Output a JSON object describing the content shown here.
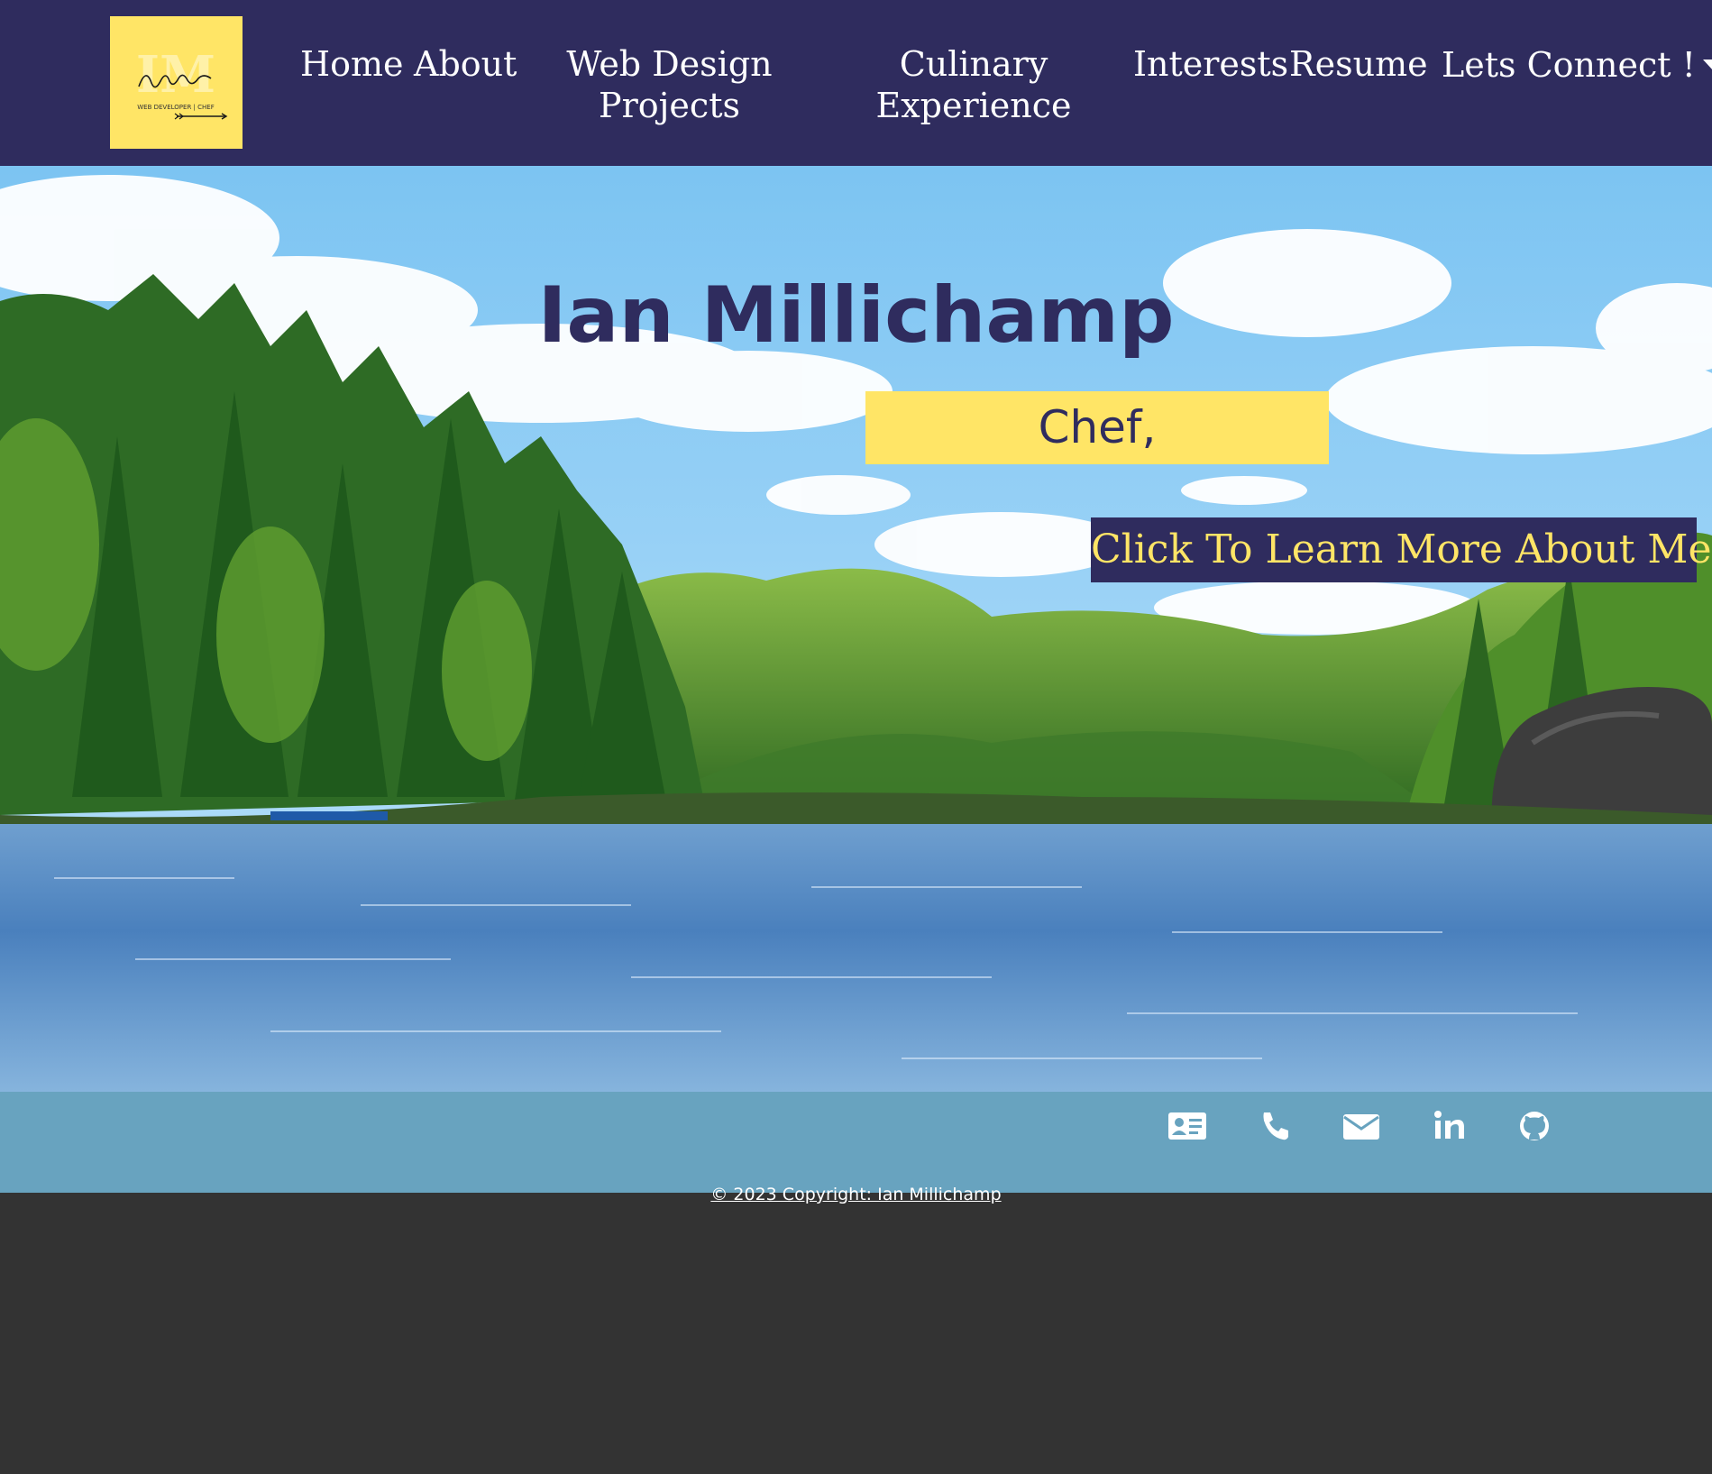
{
  "logo": {
    "initials": "IM",
    "signature": "Ian Millichamp",
    "tagline": "WEB DEVELOPER | CHEF"
  },
  "nav": {
    "items": [
      {
        "label": "Home"
      },
      {
        "label": "About"
      },
      {
        "label": "Web Design Projects"
      },
      {
        "label": "Culinary Experience"
      },
      {
        "label": "Interests"
      },
      {
        "label": "Resume"
      },
      {
        "label": "Lets Connect !"
      }
    ]
  },
  "hero": {
    "name": "Ian Millichamp",
    "role": "Chef,",
    "cta": "Click To Learn More About Me"
  },
  "social": {
    "icons": [
      "contact-card-icon",
      "phone-icon",
      "envelope-icon",
      "linkedin-icon",
      "github-icon"
    ]
  },
  "footer": {
    "copyright": "© 2023 Copyright: Ian Millichamp"
  },
  "colors": {
    "navy": "#2f2c5e",
    "yellow": "#ffe566",
    "contact_bar": "#68a3bf",
    "page_bg": "#333333"
  }
}
